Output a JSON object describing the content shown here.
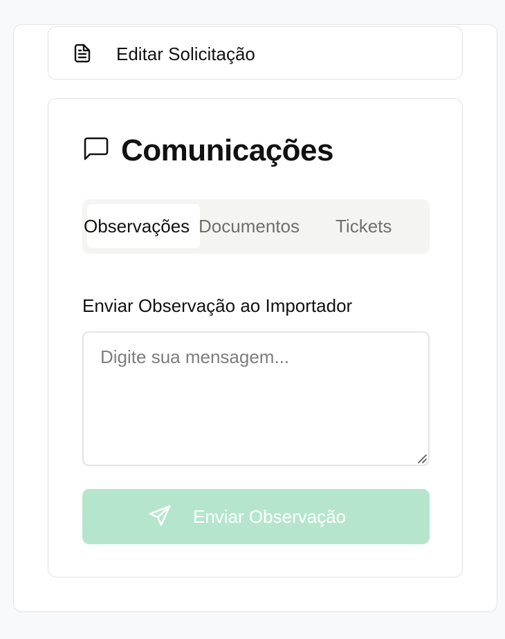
{
  "edit_request": {
    "label": "Editar Solicitação",
    "icon": "document-icon"
  },
  "communications": {
    "title": "Comunicações",
    "title_icon": "message-square-icon",
    "tabs": [
      {
        "label": "Observações",
        "active": true
      },
      {
        "label": "Documentos",
        "active": false
      },
      {
        "label": "Tickets",
        "active": false
      }
    ],
    "field_label": "Enviar Observação ao Importador",
    "message_input": {
      "value": "",
      "placeholder": "Digite sua mensagem..."
    },
    "send_button": {
      "label": "Enviar Observação",
      "icon": "send-icon",
      "color": "#b5e6cd",
      "disabled": true
    }
  },
  "colors": {
    "page_background": "#f8f9fb",
    "card_border": "#e2e2e2",
    "tab_background": "#f4f4f2",
    "inactive_tab_text": "#6f6f6f"
  }
}
